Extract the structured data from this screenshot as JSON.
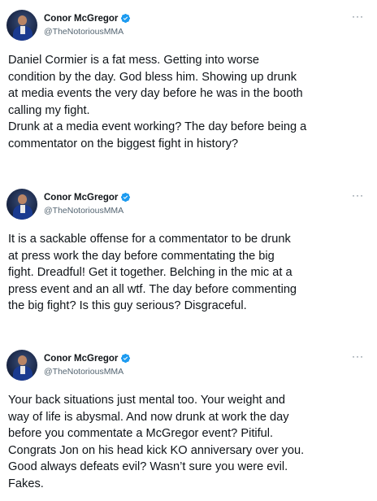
{
  "tweets": [
    {
      "author": {
        "name": "Conor McGregor",
        "handle": "@TheNotoriousMMA",
        "avatar_icon": "user-avatar",
        "verified_icon": "verified-badge-icon"
      },
      "more_label": "···",
      "text": "Daniel Cormier is a fat mess. Getting into worse\ncondition by the day. God bless him. Showing up drunk\nat media events the very day before he was in the booth\ncalling my fight.\nDrunk at a media event working? The day before being a\ncommentator on the biggest fight in history?"
    },
    {
      "author": {
        "name": "Conor McGregor",
        "handle": "@TheNotoriousMMA",
        "avatar_icon": "user-avatar",
        "verified_icon": "verified-badge-icon"
      },
      "more_label": "···",
      "text": "It is a sackable offense for a commentator to be drunk\nat press work the day before commentating the big\nfight. Dreadful! Get it together. Belching in the mic at a\npress event and an all wtf. The day before commenting\nthe big fight? Is this guy serious? Disgraceful."
    },
    {
      "author": {
        "name": "Conor McGregor",
        "handle": "@TheNotoriousMMA",
        "avatar_icon": "user-avatar",
        "verified_icon": "verified-badge-icon"
      },
      "more_label": "···",
      "text": "Your back situations just mental too. Your weight and\nway of life is abysmal. And now drunk at work the day\nbefore you commentate a McGregor event? Pitiful.\nCongrats Jon on his head kick KO anniversary over you.\nGood always defeats evil? Wasn’t sure you were evil.\nFakes."
    }
  ],
  "colors": {
    "verified_blue": "#1d9bf0",
    "handle_gray": "#536471",
    "text": "#0f1419"
  }
}
